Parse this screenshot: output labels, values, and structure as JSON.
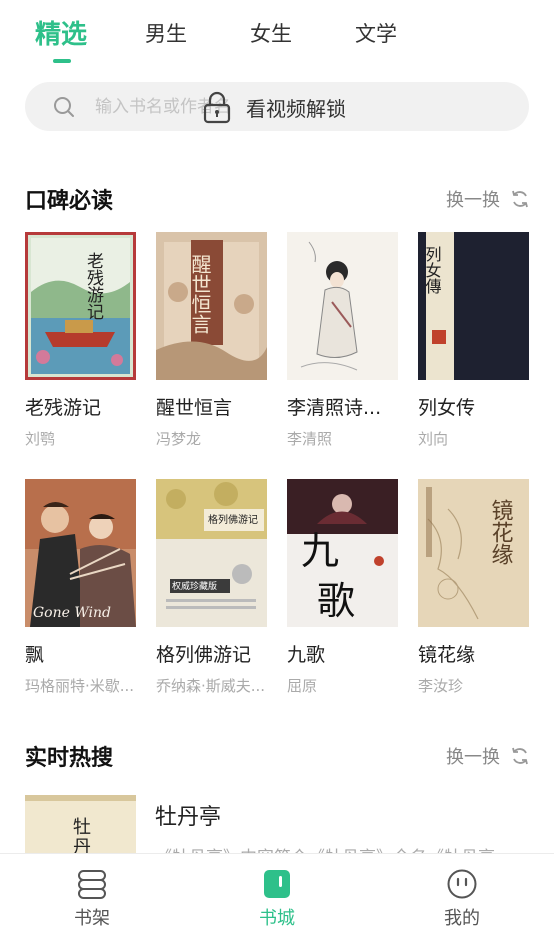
{
  "tabs": [
    {
      "label": "精选",
      "active": true
    },
    {
      "label": "男生",
      "active": false
    },
    {
      "label": "女生",
      "active": false
    },
    {
      "label": "文学",
      "active": false
    }
  ],
  "search": {
    "placeholder": "输入书名或作者名",
    "overlay_text": "看视频解锁"
  },
  "sections": {
    "recommended": {
      "title": "口碑必读",
      "refresh_label": "换一换"
    },
    "hot": {
      "title": "实时热搜",
      "refresh_label": "换一换"
    }
  },
  "books": [
    {
      "title": "老残游记",
      "author": "刘鹗"
    },
    {
      "title": "醒世恒言",
      "author": "冯梦龙"
    },
    {
      "title": "李清照诗...",
      "author": "李清照"
    },
    {
      "title": "列女传",
      "author": "刘向"
    },
    {
      "title": "飘",
      "author": "玛格丽特·米歇..."
    },
    {
      "title": "格列佛游记",
      "author": "乔纳森·斯威夫..."
    },
    {
      "title": "九歌",
      "author": "屈原"
    },
    {
      "title": "镜花缘",
      "author": "李汝珍"
    }
  ],
  "cover_text": {
    "c0": "老残游记",
    "c1": "醒世恒言",
    "c3": "列女傳",
    "c5": "格列佛游记",
    "c5_badge": "权威珍藏版",
    "c6": "九歌",
    "c7": "镜花缘",
    "hot": "牡丹"
  },
  "hot_item": {
    "title": "牡丹亭",
    "description": "《牡丹亭》内容简介《牡丹亭》全名《牡丹亭"
  },
  "bottom_nav": [
    {
      "label": "书架",
      "icon": "bookshelf-icon",
      "active": false
    },
    {
      "label": "书城",
      "icon": "bookstore-icon",
      "active": true
    },
    {
      "label": "我的",
      "icon": "profile-icon",
      "active": false
    }
  ],
  "colors": {
    "accent": "#2ec08a",
    "text_primary": "#222222",
    "text_secondary": "#aaaaaa",
    "search_bg": "#f1f1f1"
  }
}
